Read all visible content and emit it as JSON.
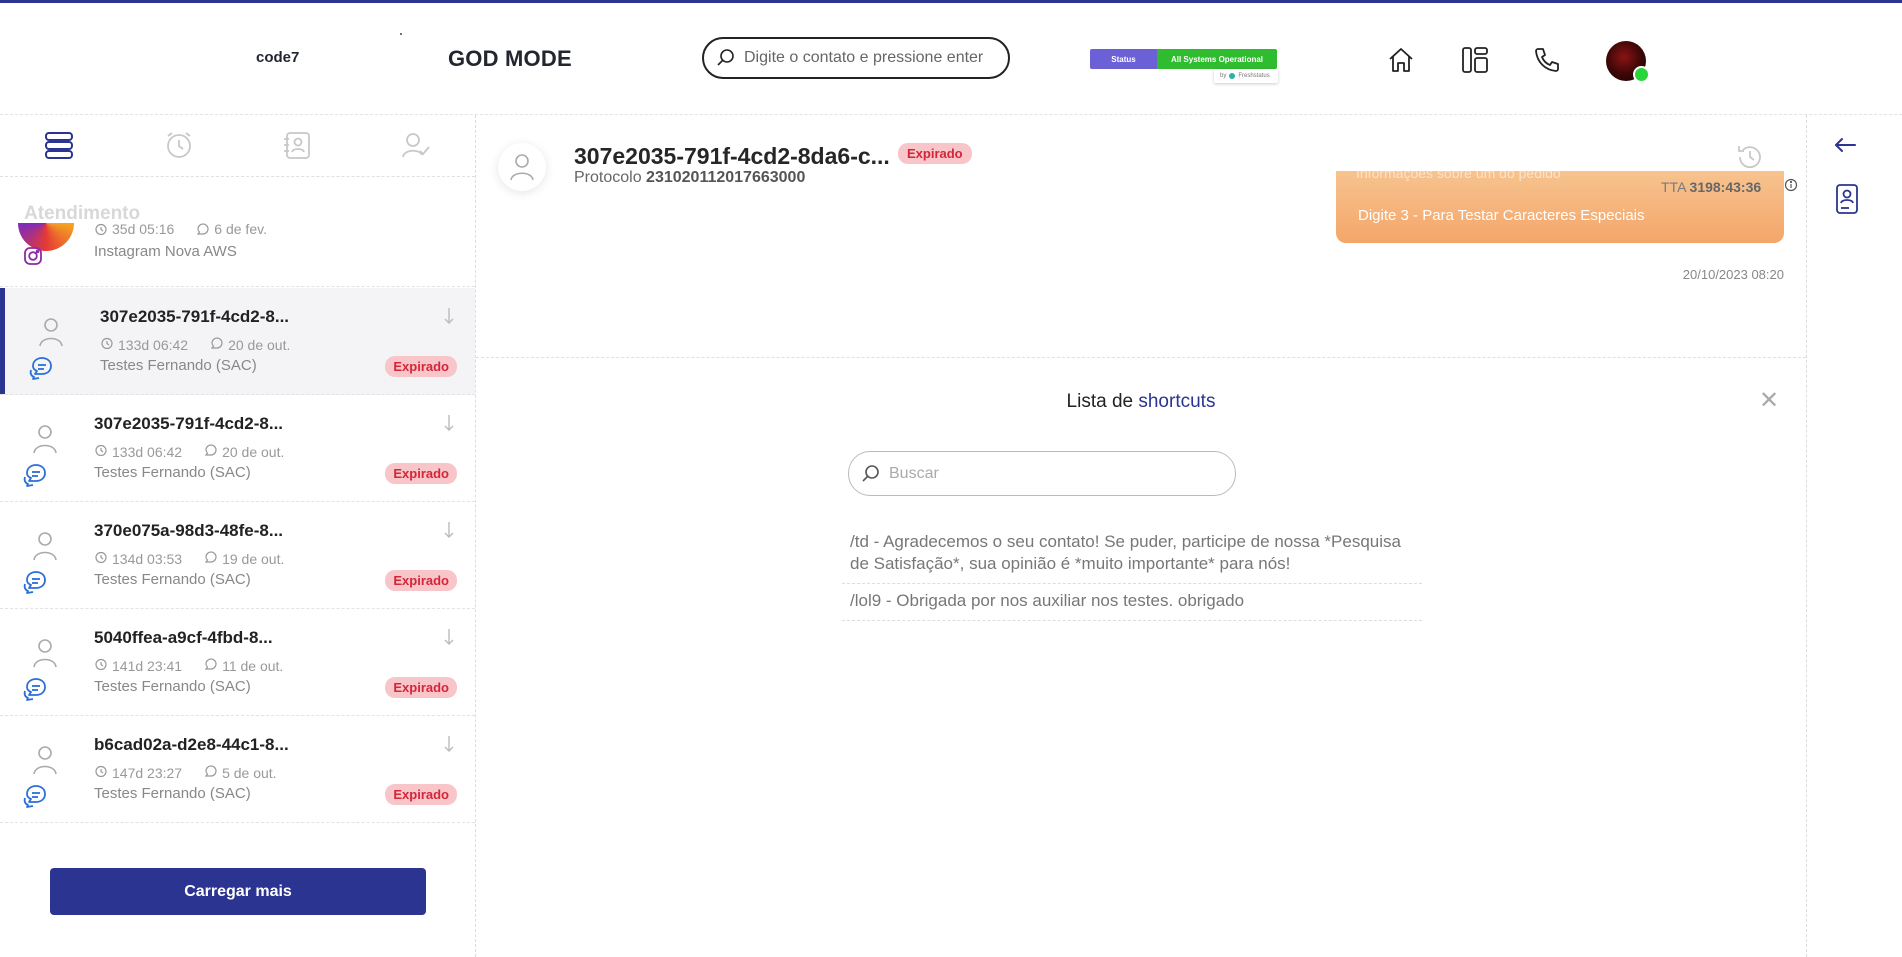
{
  "header": {
    "brand": "code7",
    "mode_label": "GOD MODE",
    "search_placeholder": "Digite o contato e pressione enter",
    "status_left": "Status",
    "status_right": "All Systems Operational",
    "status_by": "by",
    "status_provider": "Freshstatus",
    "icons": [
      "home-icon",
      "dashboard-icon",
      "phone-icon"
    ]
  },
  "sidebar": {
    "tabs": [
      "list-icon",
      "alarm-icon",
      "contacts-icon",
      "user-check-icon"
    ],
    "section_title": "Atendimento",
    "top_item": {
      "time": "35d 05:16",
      "date": "6 de fev.",
      "sub": "Instagram Nova AWS"
    },
    "items": [
      {
        "name": "307e2035-791f-4cd2-8...",
        "time": "133d 06:42",
        "date": "20 de out.",
        "sub": "Testes Fernando (SAC)",
        "badge": "Expirado",
        "active": true
      },
      {
        "name": "307e2035-791f-4cd2-8...",
        "time": "133d 06:42",
        "date": "20 de out.",
        "sub": "Testes Fernando (SAC)",
        "badge": "Expirado",
        "active": false
      },
      {
        "name": "370e075a-98d3-48fe-8...",
        "time": "134d 03:53",
        "date": "19 de out.",
        "sub": "Testes Fernando (SAC)",
        "badge": "Expirado",
        "active": false
      },
      {
        "name": "5040ffea-a9cf-4fbd-8...",
        "time": "141d 23:41",
        "date": "11 de out.",
        "sub": "Testes Fernando (SAC)",
        "badge": "Expirado",
        "active": false
      },
      {
        "name": "b6cad02a-d2e8-44c1-8...",
        "time": "147d 23:27",
        "date": "5 de out.",
        "sub": "Testes Fernando (SAC)",
        "badge": "Expirado",
        "active": false
      }
    ],
    "load_more": "Carregar mais"
  },
  "chat": {
    "title": "307e2035-791f-4cd2-8da6-c...",
    "badge": "Expirado",
    "protocol_label": "Protocolo",
    "protocol_value": "23102011201766300​0",
    "bubble_ghost": "Informações sobre um do pedido",
    "bubble_text": "Digite 3 - Para Testar Caracteres Especiais",
    "tta_label": "TTA",
    "tta_value": "3198:43:36",
    "msg_time": "20/10/2023 08:20"
  },
  "shortcuts": {
    "title_prefix": "Lista de",
    "title_emphasis": "shortcuts",
    "search_placeholder": "Buscar",
    "items": [
      "/td - Agradecemos o seu contato! Se puder, participe de nossa *Pesquisa de Satisfação*, sua opinião é *muito importante* para nós!",
      "/lol9 - Obrigada por nos auxiliar nos testes. obrigado"
    ]
  },
  "colors": {
    "primary": "#2b3490",
    "expired_bg": "#f8c5c9",
    "expired_text": "#d4263a",
    "bubble": "#f4a66a",
    "online": "#2ad53a"
  }
}
